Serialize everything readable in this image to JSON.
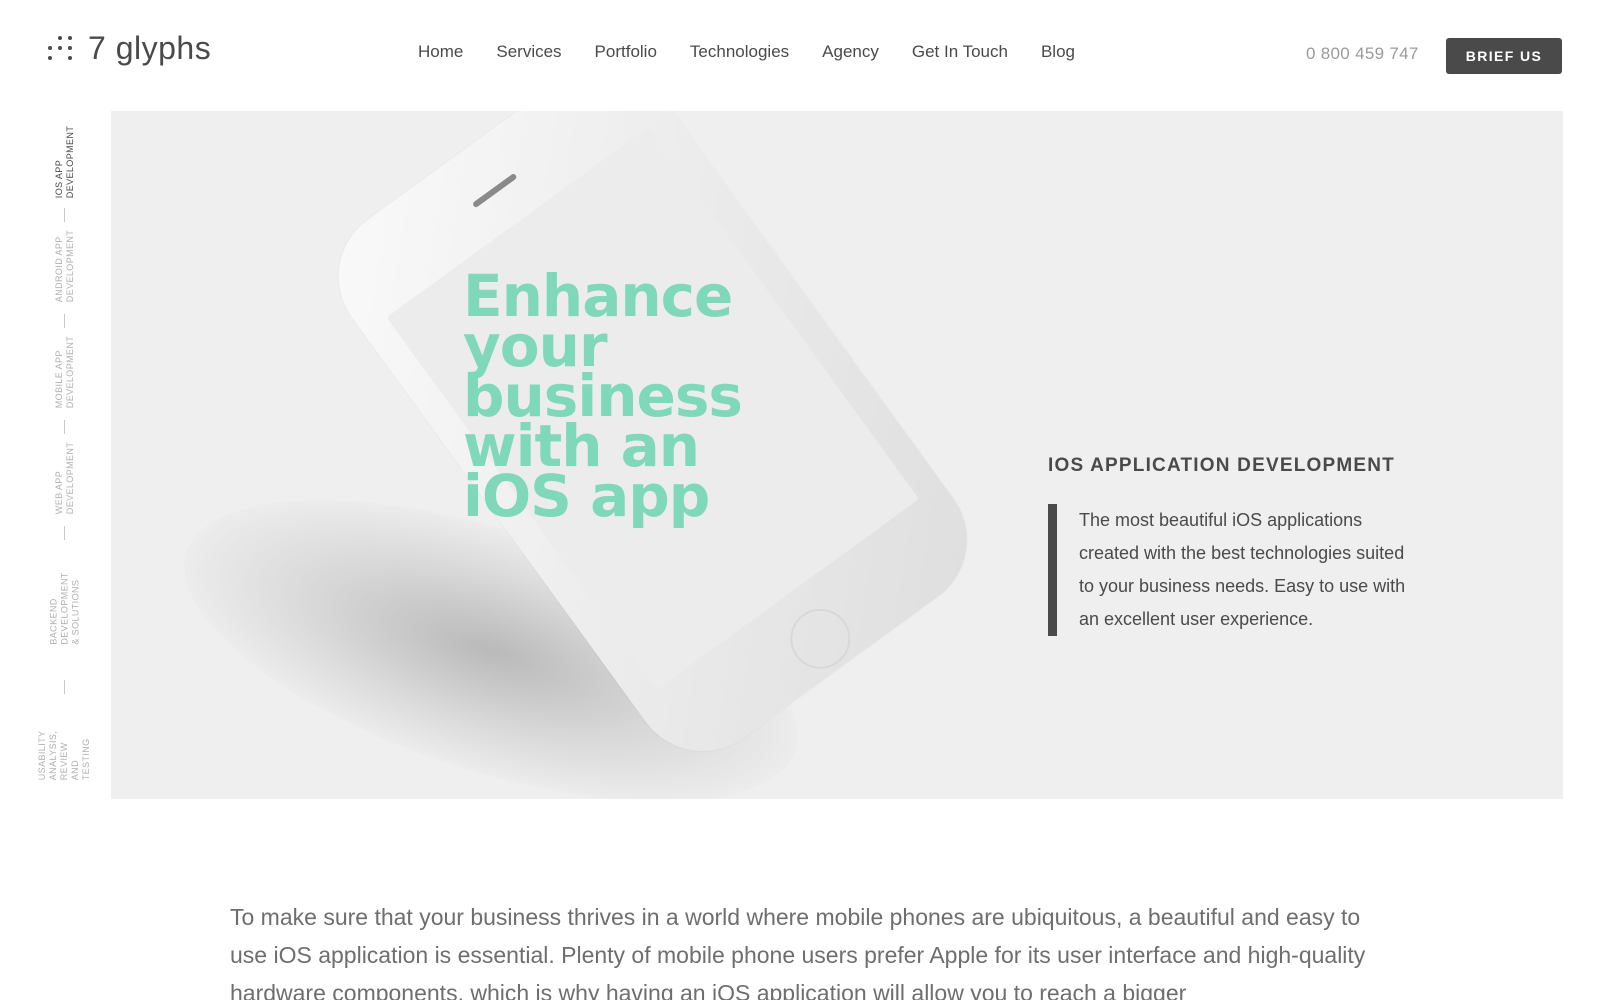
{
  "header": {
    "logo_text": "7 glyphs",
    "nav": [
      "Home",
      "Services",
      "Portfolio",
      "Technologies",
      "Agency",
      "Get In Touch",
      "Blog"
    ],
    "phone": "0 800 459 747",
    "cta": "BRIEF US"
  },
  "sidenav": {
    "items": [
      "iOS APP DEVELOPMENT",
      "ANDROID APP DEVELOPMENT",
      "MOBILE APP DEVELOPMENT",
      "WEB APP DEVELOPMENT",
      "BACKEND DEVELOPMENT & SOLUTIONS",
      "USABILITY ANALYSIS, REVIEW AND TESTING"
    ],
    "active_index": 0
  },
  "hero": {
    "headline": "Enhance your business with an iOS app",
    "service_title": "IOS APPLICATION DEVELOPMENT",
    "service_description": "The most beautiful iOS applications created with the best technologies suited to your business needs. Easy to use with an excellent user experience.",
    "accent_color": "#7fd8b9"
  },
  "intro": {
    "text": "To make sure that your business thrives in a world where mobile phones are ubiquitous, a beautiful and easy to use iOS application is essential. Plenty of mobile phone users prefer Apple for its user interface and high-quality hardware components, which is why having an iOS application will allow you to reach a bigger"
  }
}
